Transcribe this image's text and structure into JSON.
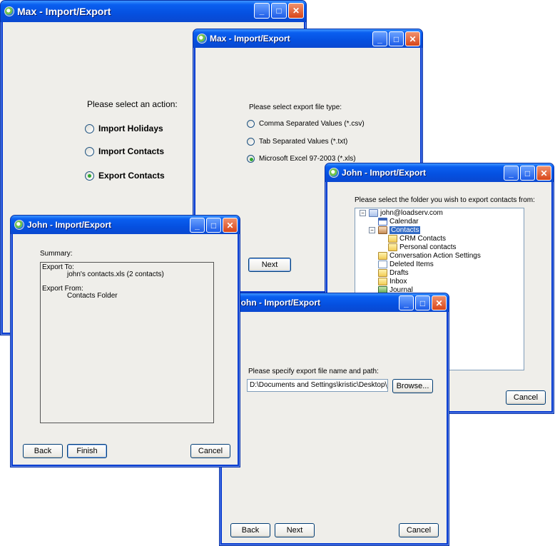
{
  "colors": {
    "titlebar": "#0a5ff0",
    "face": "#efeeea",
    "selection": "#316ac5"
  },
  "icons": {
    "app": "app-icon",
    "minimize": "minimize-icon",
    "maximize": "maximize-icon",
    "close": "close-icon"
  },
  "w1": {
    "title": "Max - Import/Export",
    "prompt": "Please select an action:",
    "options": [
      {
        "label": "Import Holidays",
        "checked": false
      },
      {
        "label": "Import Contacts",
        "checked": false
      },
      {
        "label": "Export Contacts",
        "checked": true
      }
    ]
  },
  "w2": {
    "title": "Max - Import/Export",
    "prompt": "Please select export file type:",
    "options": [
      {
        "label": "Comma Separated Values (*.csv)",
        "checked": false
      },
      {
        "label": "Tab Separated Values (*.txt)",
        "checked": false
      },
      {
        "label": "Microsoft Excel 97-2003 (*.xls)",
        "checked": true
      }
    ],
    "next_label": "Next"
  },
  "w3": {
    "title": "John - Import/Export",
    "prompt": "Please select the folder you wish to export contacts from:",
    "tree": [
      {
        "label": "john@loadserv.com",
        "icon": "mailbox-icon"
      },
      {
        "label": "Calendar",
        "icon": "calendar-folder-icon"
      },
      {
        "label": "Contacts",
        "icon": "contacts-folder-icon",
        "selected": true
      },
      {
        "label": "CRM Contacts",
        "icon": "folder-icon"
      },
      {
        "label": "Personal contacts",
        "icon": "folder-icon"
      },
      {
        "label": "Conversation Action Settings",
        "icon": "folder-icon"
      },
      {
        "label": "Deleted Items",
        "icon": "deleted-items-icon"
      },
      {
        "label": "Drafts",
        "icon": "drafts-icon"
      },
      {
        "label": "Inbox",
        "icon": "inbox-icon"
      },
      {
        "label": "Journal",
        "icon": "journal-icon"
      }
    ],
    "cancel_label": "Cancel"
  },
  "w4": {
    "title": "John - Import/Export",
    "summary_label": "Summary:",
    "export_to_label": "Export To:",
    "export_to_value": "john's contacts.xls (2 contacts)",
    "export_from_label": "Export From:",
    "export_from_value": "Contacts Folder",
    "back_label": "Back",
    "finish_label": "Finish",
    "cancel_label": "Cancel"
  },
  "w5": {
    "title": "John - Import/Export",
    "prompt": "Please specify export file name and path:",
    "path_value": "D:\\Documents and Settings\\kristic\\Desktop\\john's co",
    "browse_label": "Browse...",
    "back_label": "Back",
    "next_label": "Next",
    "cancel_label": "Cancel"
  }
}
